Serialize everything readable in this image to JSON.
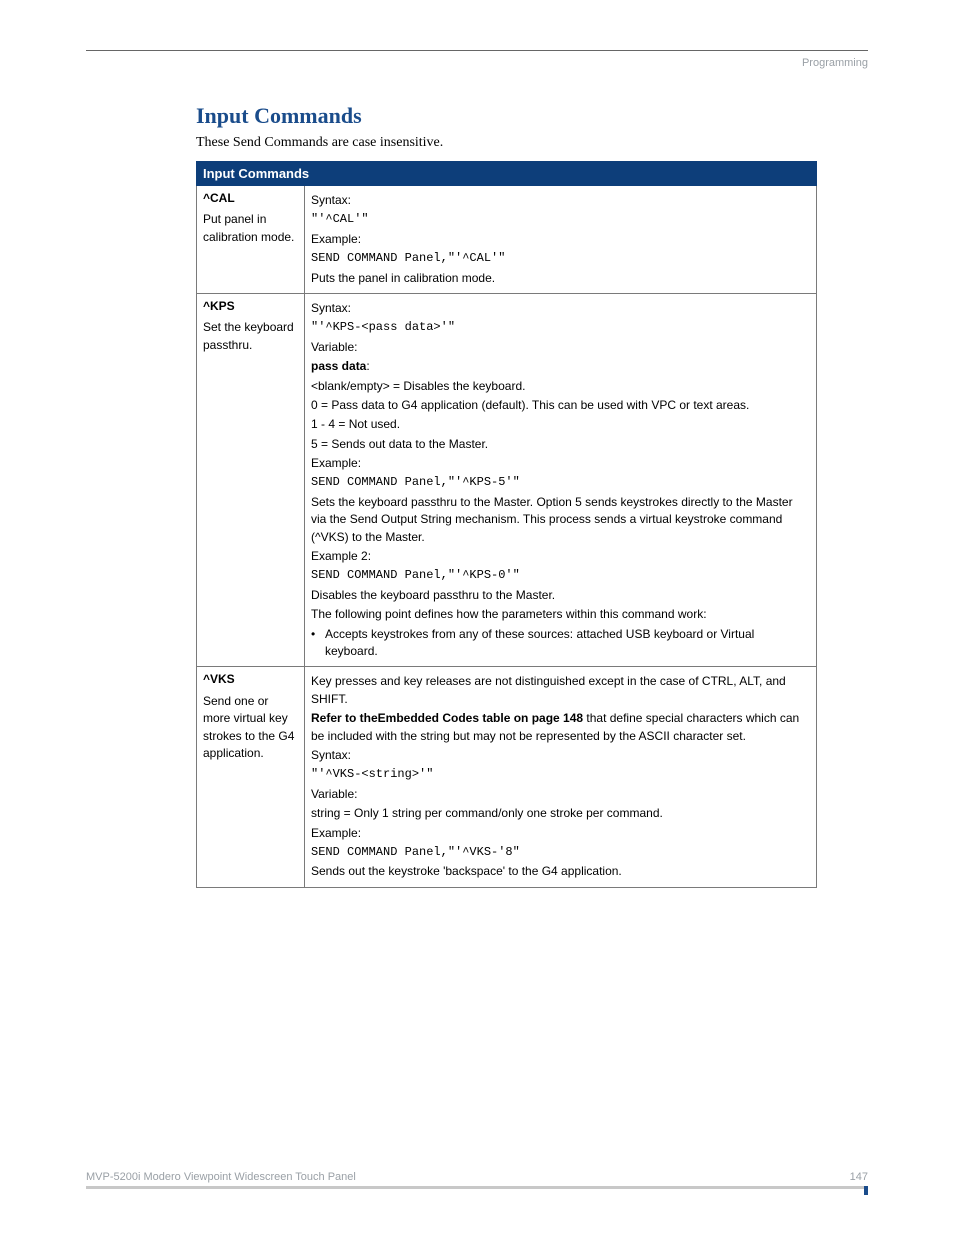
{
  "header": {
    "section": "Programming"
  },
  "title": "Input Commands",
  "intro": "These Send Commands are case insensitive.",
  "table_header": "Input Commands",
  "rows": {
    "cal": {
      "name": "^CAL",
      "desc": "Put panel in calibration mode.",
      "syntax_label": "Syntax:",
      "syntax": "\"'^CAL'\"",
      "example_label": "Example:",
      "example": "SEND COMMAND Panel,\"'^CAL'\"",
      "result": "Puts the panel in calibration mode."
    },
    "kps": {
      "name": "^KPS",
      "desc": "Set the keyboard passthru.",
      "syntax_label": "Syntax:",
      "syntax": "\"'^KPS-<pass data>'\"",
      "variable_label": "Variable:",
      "passdata_label": "pass data",
      "passdata_colon": ":",
      "v_blank": "<blank/empty> = Disables the keyboard.",
      "v_0": "0 = Pass data to G4 application (default). This can be used with VPC or text areas.",
      "v_14": "1 - 4 = Not used.",
      "v_5": "5 = Sends out data to the Master.",
      "example_label": "Example:",
      "example": "SEND COMMAND Panel,\"'^KPS-5'\"",
      "result": "Sets the keyboard passthru to the Master. Option 5 sends keystrokes directly to the Master via the Send Output String mechanism. This process sends a virtual keystroke command (^VKS) to the Master.",
      "example2_label": "Example 2:",
      "example2": "SEND COMMAND Panel,\"'^KPS-0'\"",
      "result2": "Disables the keyboard passthru to the Master.",
      "following": "The following point defines how the parameters within this command work:",
      "bullet": "Accepts keystrokes from any of these sources: attached USB keyboard or Virtual keyboard."
    },
    "vks": {
      "name": "^VKS",
      "desc": "Send one or more virtual key strokes to the G4 application.",
      "note1": "Key presses and key releases are not distinguished except in the case of CTRL, ALT, and SHIFT.",
      "refer_bold": "Refer to theEmbedded Codes table on page 148",
      "refer_rest": " that define special characters which can be included with the string but may not be represented by the ASCII character set.",
      "syntax_label": "Syntax:",
      "syntax": "\"'^VKS-<string>'\"",
      "variable_label": "Variable:",
      "var_string": "string = Only 1 string per command/only one stroke per command.",
      "example_label": "Example:",
      "example": "SEND COMMAND Panel,\"'^VKS-'8\"",
      "result": "Sends out the keystroke 'backspace' to the G4 application."
    }
  },
  "footer": {
    "left": "MVP-5200i Modero Viewpoint Widescreen Touch Panel",
    "right": "147"
  }
}
